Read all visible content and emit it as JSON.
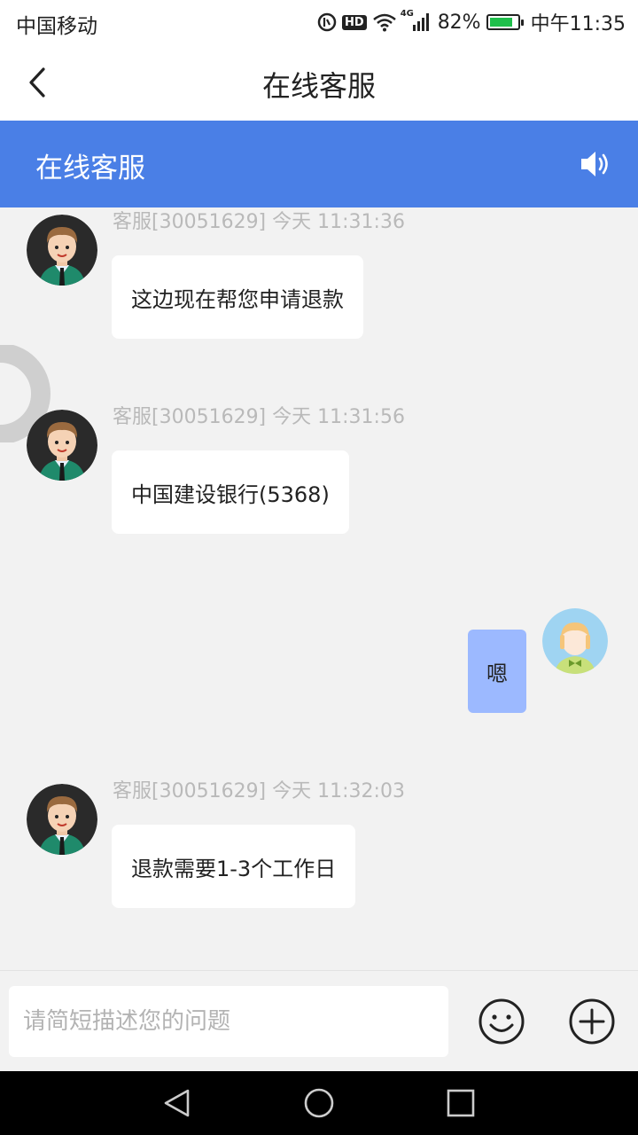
{
  "status_bar": {
    "carrier": "中国移动",
    "hd": "HD",
    "network": "4G",
    "battery_percent": "82%",
    "battery_level": 0.82,
    "time": "中午11:35"
  },
  "nav": {
    "title": "在线客服"
  },
  "chat_header": {
    "title": "在线客服"
  },
  "messages": [
    {
      "sender": "agent",
      "meta": "客服[30051629]  今天 11:31:36",
      "text": "这边现在帮您申请退款"
    },
    {
      "sender": "agent",
      "meta": "客服[30051629]  今天 11:31:56",
      "text": "中国建设银行(5368)"
    },
    {
      "sender": "user",
      "text": "嗯"
    },
    {
      "sender": "agent",
      "meta": "客服[30051629]  今天 11:32:03",
      "text": "退款需要1-3个工作日"
    }
  ],
  "input": {
    "placeholder": "请简短描述您的问题",
    "value": ""
  },
  "colors": {
    "header_blue": "#4a7fe6",
    "user_bubble": "#9cb9ff",
    "meta_text": "#b9b9b9"
  }
}
